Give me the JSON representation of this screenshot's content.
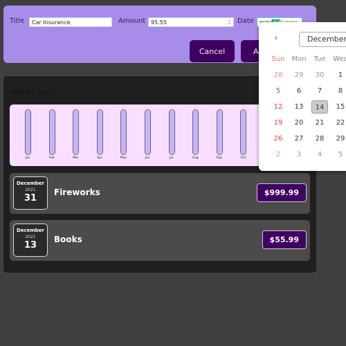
{
  "form": {
    "title_label": "Title",
    "title_value": "Car Insurance",
    "amount_label": "Amount",
    "amount_value": "95.55",
    "date_label": "Date",
    "date_mm": "mm",
    "date_dd": "dd",
    "date_yyyy": "yyyy",
    "cancel_label": "Cancel",
    "add_label": "Add Expense"
  },
  "filter": {
    "label": "Filter by year"
  },
  "chart_data": {
    "type": "bar",
    "categories": [
      "Jan",
      "Feb",
      "Mar",
      "Apr",
      "May",
      "Jun",
      "Jul",
      "Aug",
      "Sep",
      "Oct"
    ],
    "values": [
      1,
      1,
      1,
      1,
      1,
      1,
      1,
      1,
      1,
      1
    ],
    "title": "",
    "xlabel": "",
    "ylabel": "",
    "ylim": [
      0,
      1
    ]
  },
  "expenses": [
    {
      "month": "December",
      "year": "2021",
      "day": "31",
      "title": "Fireworks",
      "amount": "$999.99"
    },
    {
      "month": "December",
      "year": "2021",
      "day": "13",
      "title": "Books",
      "amount": "$55.99"
    }
  ],
  "calendar": {
    "month": "December",
    "weekdays": [
      "Sun",
      "Mon",
      "Tue",
      "Wed"
    ],
    "weeks": [
      [
        "28",
        "29",
        "30",
        "1"
      ],
      [
        "5",
        "6",
        "7",
        "8"
      ],
      [
        "12",
        "13",
        "14",
        "15"
      ],
      [
        "19",
        "20",
        "21",
        "22"
      ],
      [
        "26",
        "27",
        "28",
        "29"
      ],
      [
        "2",
        "3",
        "4",
        "5"
      ]
    ],
    "today": "14"
  }
}
